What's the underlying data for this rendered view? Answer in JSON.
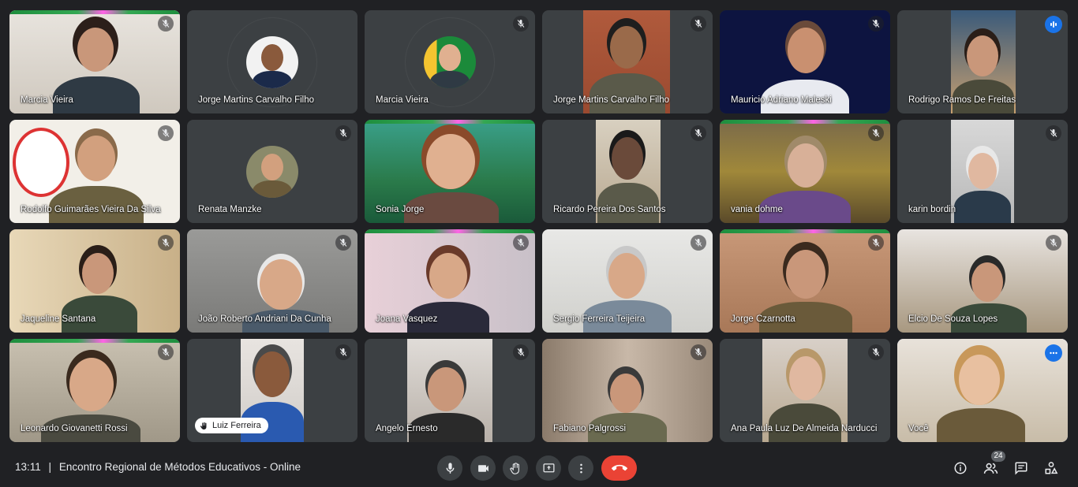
{
  "participants": [
    {
      "name": "Marcia Vieira",
      "muted": true,
      "speaking": true
    },
    {
      "name": "Jorge Martins Carvalho Filho",
      "muted": false,
      "avatar": true
    },
    {
      "name": "Marcia Vieira",
      "muted": true,
      "avatar": true
    },
    {
      "name": "Jorge Martins Carvalho Filho",
      "muted": true
    },
    {
      "name": "Mauricio Adriano Maleski",
      "muted": true
    },
    {
      "name": "Rodrigo Ramos De Freitas",
      "muted": false,
      "active_speaker": true
    },
    {
      "name": "Rodolfo Guimarães Vieira Da Silva",
      "muted": true
    },
    {
      "name": "Renata Manzke",
      "muted": true,
      "avatar": true
    },
    {
      "name": "Sonia Jorge",
      "muted": false,
      "speaking": true
    },
    {
      "name": "Ricardo Pereira Dos Santos",
      "muted": true
    },
    {
      "name": "vania dohme",
      "muted": true,
      "speaking": true
    },
    {
      "name": "karin bordin",
      "muted": true
    },
    {
      "name": "Jaqueline Santana",
      "muted": true
    },
    {
      "name": "João Roberto Andriani Da Cunha",
      "muted": true
    },
    {
      "name": "Joana Vasquez",
      "muted": true,
      "speaking": true
    },
    {
      "name": "Sergio Ferreira Teijeira",
      "muted": true
    },
    {
      "name": "Jorge Czarnotta",
      "muted": true,
      "speaking": true
    },
    {
      "name": "Elcio De Souza Lopes",
      "muted": true
    },
    {
      "name": "Leonardo Giovanetti Rossi",
      "muted": true,
      "speaking": true
    },
    {
      "name": "Luiz Ferreira",
      "muted": true,
      "raised_hand": true
    },
    {
      "name": "Angelo Ernesto",
      "muted": true
    },
    {
      "name": "Fabiano Palgrossi",
      "muted": true
    },
    {
      "name": "Ana Paula Luz De Almeida Narducci",
      "muted": true
    },
    {
      "name": "Você",
      "muted": false,
      "self": true
    }
  ],
  "bottom_bar": {
    "time": "13:11",
    "separator": "|",
    "meeting_title": "Encontro Regional de Métodos Educativos - Online",
    "participant_count": "24"
  },
  "icons": {
    "mic": "mic-icon",
    "camera": "camera-icon",
    "raise_hand": "hand-icon",
    "present": "present-screen-icon",
    "more": "more-vert-icon",
    "end_call": "end-call-icon",
    "info": "info-icon",
    "people": "people-icon",
    "chat": "chat-icon",
    "activities": "activities-icon"
  },
  "colors": {
    "background": "#202124",
    "tile": "#3c4043",
    "end_call": "#ea4335",
    "accent": "#1a73e8",
    "speaking": "#34a853"
  }
}
